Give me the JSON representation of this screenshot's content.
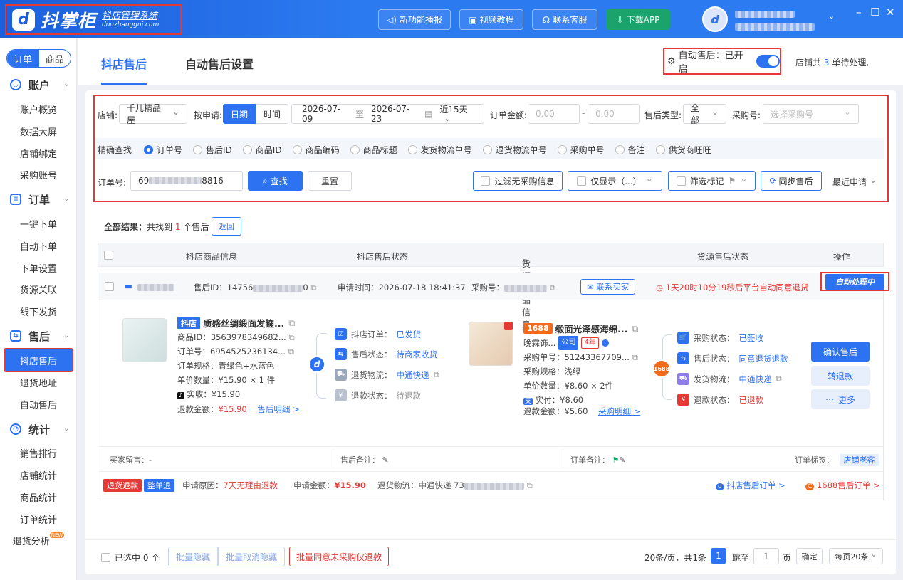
{
  "app": {
    "logo_name": "抖掌柜",
    "logo_sub": "抖店管理系统",
    "logo_domain": "douzhanggui.com"
  },
  "topbar": {
    "new_feature": "新功能播报",
    "video": "视频教程",
    "service": "联系客服",
    "download": "下载APP"
  },
  "sidebar": {
    "seg_order": "订单",
    "seg_goods": "商品",
    "groups": [
      {
        "label": "账户",
        "items": [
          "账户概览",
          "数据大屏",
          "店铺绑定",
          "采购账号"
        ]
      },
      {
        "label": "订单",
        "items": [
          "一键下单",
          "自动下单",
          "下单设置",
          "货源关联",
          "线下发货"
        ]
      },
      {
        "label": "售后",
        "items": [
          "抖店售后",
          "退货地址",
          "自动售后"
        ]
      },
      {
        "label": "统计",
        "items": [
          "销售排行",
          "店铺统计",
          "商品统计",
          "订单统计",
          "退货分析"
        ]
      }
    ],
    "new_badge": "NEW"
  },
  "tabs": {
    "active": "抖店售后",
    "other": "自动售后设置"
  },
  "auto": {
    "label": "自动售后：已开启",
    "pending_prefix": "店铺共",
    "pending_count": "3",
    "pending_suffix": "单待处理,"
  },
  "filter": {
    "shop_label": "店铺:",
    "shop_value": "千儿精品屋",
    "by_label": "按申请:",
    "by_date": "日期",
    "by_time": "时间",
    "date_from": "2026-07-09",
    "date_to_word": "至",
    "date_to": "2026-07-23",
    "range": "近15天",
    "amount_label": "订单金额:",
    "amount_min": "0.00",
    "amount_max": "0.00",
    "type_label": "售后类型:",
    "type_value": "全部",
    "purchase_label": "采购号:",
    "purchase_placeholder": "选择采购号",
    "exact_label": "精确查找",
    "radios": [
      "订单号",
      "售后ID",
      "商品ID",
      "商品编码",
      "商品标题",
      "发货物流单号",
      "退货物流单号",
      "采购单号",
      "备注",
      "供货商旺旺"
    ],
    "order_label": "订单号:",
    "order_prefix": "69",
    "order_suffix": "8816",
    "search": "查找",
    "reset": "重置",
    "filter_no_purchase": "过滤无采购信息",
    "only_show": "仅显示（...）",
    "mark_filter": "筛选标记",
    "sync": "同步售后",
    "recent": "最近申请"
  },
  "results": {
    "prefix": "全部结果：",
    "found": "共找到",
    "count": "1",
    "suffix": "个售后",
    "back": "返回"
  },
  "table_headers": [
    "抖店商品信息",
    "抖店售后状态",
    "货源商品信息",
    "货源售后状态",
    "操作"
  ],
  "order": {
    "aftersale_id_label": "售后ID：",
    "aftersale_id_prefix": "14756",
    "aftersale_id_suffix": "0",
    "apply_time": "申请时间：2026-07-18 18:41:37",
    "purchase_no_label": "采购号：",
    "contact": "联系买家",
    "countdown": "1天20时10分19秒后平台自动同意退货",
    "auto_tag": "自动处理中",
    "dy": {
      "tag": "抖店",
      "title": "质感丝绸缎面发箍...",
      "goods_id": "商品ID：3563978349682...",
      "order_no": "订单号：6954525236134...",
      "spec": "订单规格：青绿色+水蓝色",
      "price": "单价数量：¥15.90 × 1 件",
      "paid": "实收：¥15.90",
      "refund_label": "退款金额：",
      "refund": "¥15.90",
      "detail": "售后明细 >"
    },
    "dy_status": [
      {
        "label": "抖店订单：",
        "value": "已发货"
      },
      {
        "label": "售后状态：",
        "value": "待商家收货"
      },
      {
        "label": "退货物流：",
        "value": "中通快递"
      },
      {
        "label": "退款状态：",
        "value": "待退款"
      }
    ],
    "src": {
      "tag": "1688",
      "title": "缎面光泽感海绵...",
      "shop": "晚霖饰...",
      "company": "公司",
      "years": "4年",
      "purchase_no": "采购单号：51243367709...",
      "spec": "采购规格：浅绿",
      "price": "单价数量：¥8.60 × 2件",
      "paid": "实付：¥8.60",
      "refund": "退款金额：¥5.60",
      "detail": "采购明细 >"
    },
    "src_status": [
      {
        "label": "采购状态：",
        "value": "已签收"
      },
      {
        "label": "售后状态：",
        "value": "同意退货退款"
      },
      {
        "label": "发货物流：",
        "value": "中通快递"
      },
      {
        "label": "退款状态：",
        "value": "已退款"
      }
    ],
    "actions": {
      "confirm": "确认售后",
      "refund": "转退款",
      "more": "更多"
    },
    "buyer_msg": "买家留言：-",
    "after_note": "售后备注：",
    "order_note": "订单备注：",
    "order_tag_label": "订单标签：",
    "order_tag": "店铺老客",
    "type_tag1": "退货退款",
    "type_tag2": "整单退",
    "reason_label": "申请原因：",
    "reason": "7天无理由退款",
    "amount_label": "申请金额：",
    "amount": "¥15.90",
    "logistics_label": "退货物流：",
    "logistics": "中通快递 73",
    "dy_link": "抖店售后订单 >",
    "src_link": "1688售后订单 >"
  },
  "footer": {
    "selected": "已选中 0 个",
    "batch_hide": "批量隐藏",
    "batch_unhide": "批量取消隐藏",
    "batch_agree": "批量同意未采购仅退款",
    "per_page_info": "20条/页，共1条",
    "page": "1",
    "jump": "跳至",
    "jump_value": "1",
    "page_word": "页",
    "ok": "确定",
    "per_page": "每页20条"
  },
  "colors": {
    "primary": "#2d72f0",
    "red": "#e53935",
    "green": "#1aa36b"
  }
}
